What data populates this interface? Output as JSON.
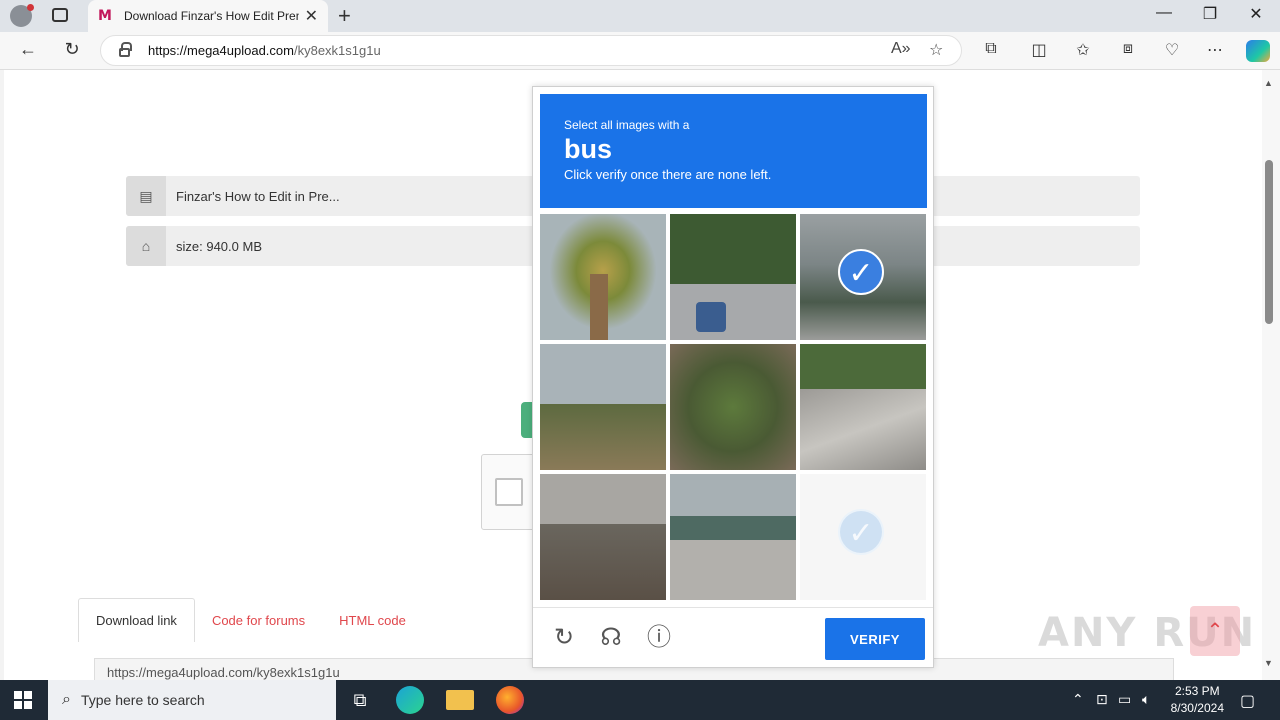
{
  "browser": {
    "tab_title": "Download Finzar's How Edit Pren",
    "url_host": "https://mega4upload.com",
    "url_path": "/ky8exk1s1g1u"
  },
  "page": {
    "file_name": "Finzar's How to Edit in Pre...",
    "file_size": "size: 940.0 MB",
    "tabs": [
      "Download link",
      "Code for forums",
      "HTML code"
    ],
    "link_text": "https://mega4upload.com/ky8exk1s1g1u"
  },
  "captcha": {
    "instruction_line1": "Select all images with a",
    "target_word": "bus",
    "instruction_line3": "Click verify once there are none left.",
    "verify_label": "VERIFY",
    "tiles": [
      {
        "scene": "palm tree",
        "selected": false
      },
      {
        "scene": "street with car",
        "selected": false
      },
      {
        "scene": "bus",
        "selected": true
      },
      {
        "scene": "highway",
        "selected": false
      },
      {
        "scene": "garden",
        "selected": false
      },
      {
        "scene": "crosswalk",
        "selected": false
      },
      {
        "scene": "road",
        "selected": false
      },
      {
        "scene": "parking lot",
        "selected": false
      },
      {
        "scene": "loading",
        "selected": true
      }
    ]
  },
  "watermark": "ANY RUN",
  "taskbar": {
    "search_placeholder": "Type here to search",
    "time": "2:53 PM",
    "date": "8/30/2024"
  }
}
